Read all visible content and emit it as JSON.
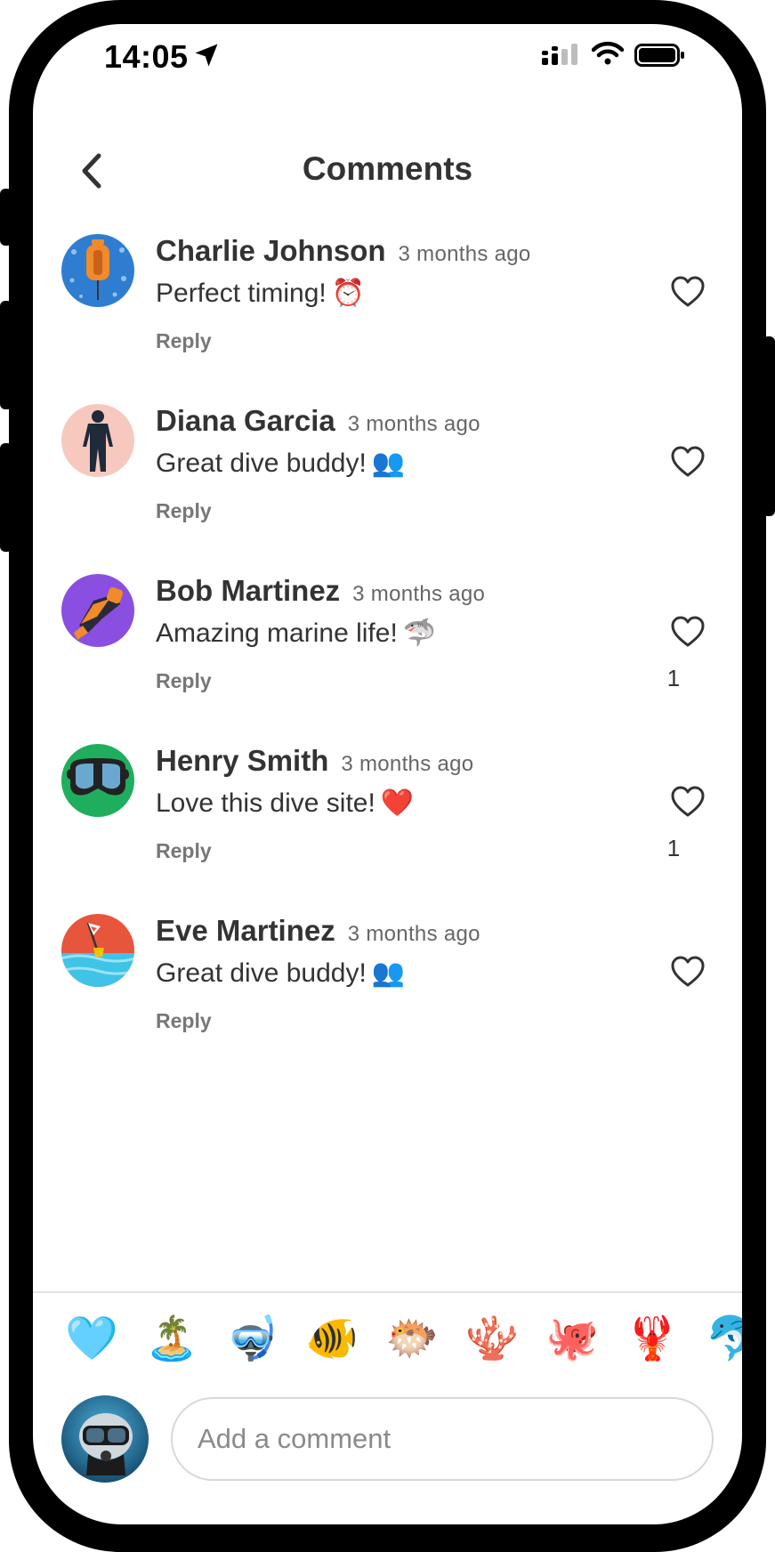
{
  "status_bar": {
    "time": "14:05"
  },
  "header": {
    "title": "Comments"
  },
  "comments": [
    {
      "name": "Charlie Johnson",
      "time_ago": "3 months ago",
      "text": "Perfect timing!",
      "emoji": "⏰",
      "reply_label": "Reply",
      "likes": "",
      "avatar_icon": "diving-buoy",
      "avatar_color": "#2f7dd1"
    },
    {
      "name": "Diana Garcia",
      "time_ago": "3 months ago",
      "text": "Great dive buddy!",
      "emoji": "👥",
      "reply_label": "Reply",
      "likes": "",
      "avatar_icon": "wetsuit",
      "avatar_color": "#f7c9be"
    },
    {
      "name": "Bob Martinez",
      "time_ago": "3 months ago",
      "text": "Amazing marine life!",
      "emoji": "🦈",
      "reply_label": "Reply",
      "likes": "1",
      "avatar_icon": "fins",
      "avatar_color": "#8a4fe0"
    },
    {
      "name": "Henry Smith",
      "time_ago": "3 months ago",
      "text": "Love this dive site!",
      "emoji": "❤️",
      "reply_label": "Reply",
      "likes": "1",
      "avatar_icon": "dive-mask",
      "avatar_color": "#1fae5e"
    },
    {
      "name": "Eve Martinez",
      "time_ago": "3 months ago",
      "text": "Great dive buddy!",
      "emoji": "👥",
      "reply_label": "Reply",
      "likes": "",
      "avatar_icon": "dive-flag-buoy",
      "avatar_color": "#3fc3e6"
    }
  ],
  "reactions": [
    "🩵",
    "🏝️",
    "🤿",
    "🐠",
    "🐡",
    "🪸",
    "🐙",
    "🦞",
    "🐬"
  ],
  "composer": {
    "placeholder": "Add a comment"
  },
  "colors": {
    "text": "#333333",
    "muted": "#777777",
    "divider": "#e3e3e3"
  }
}
